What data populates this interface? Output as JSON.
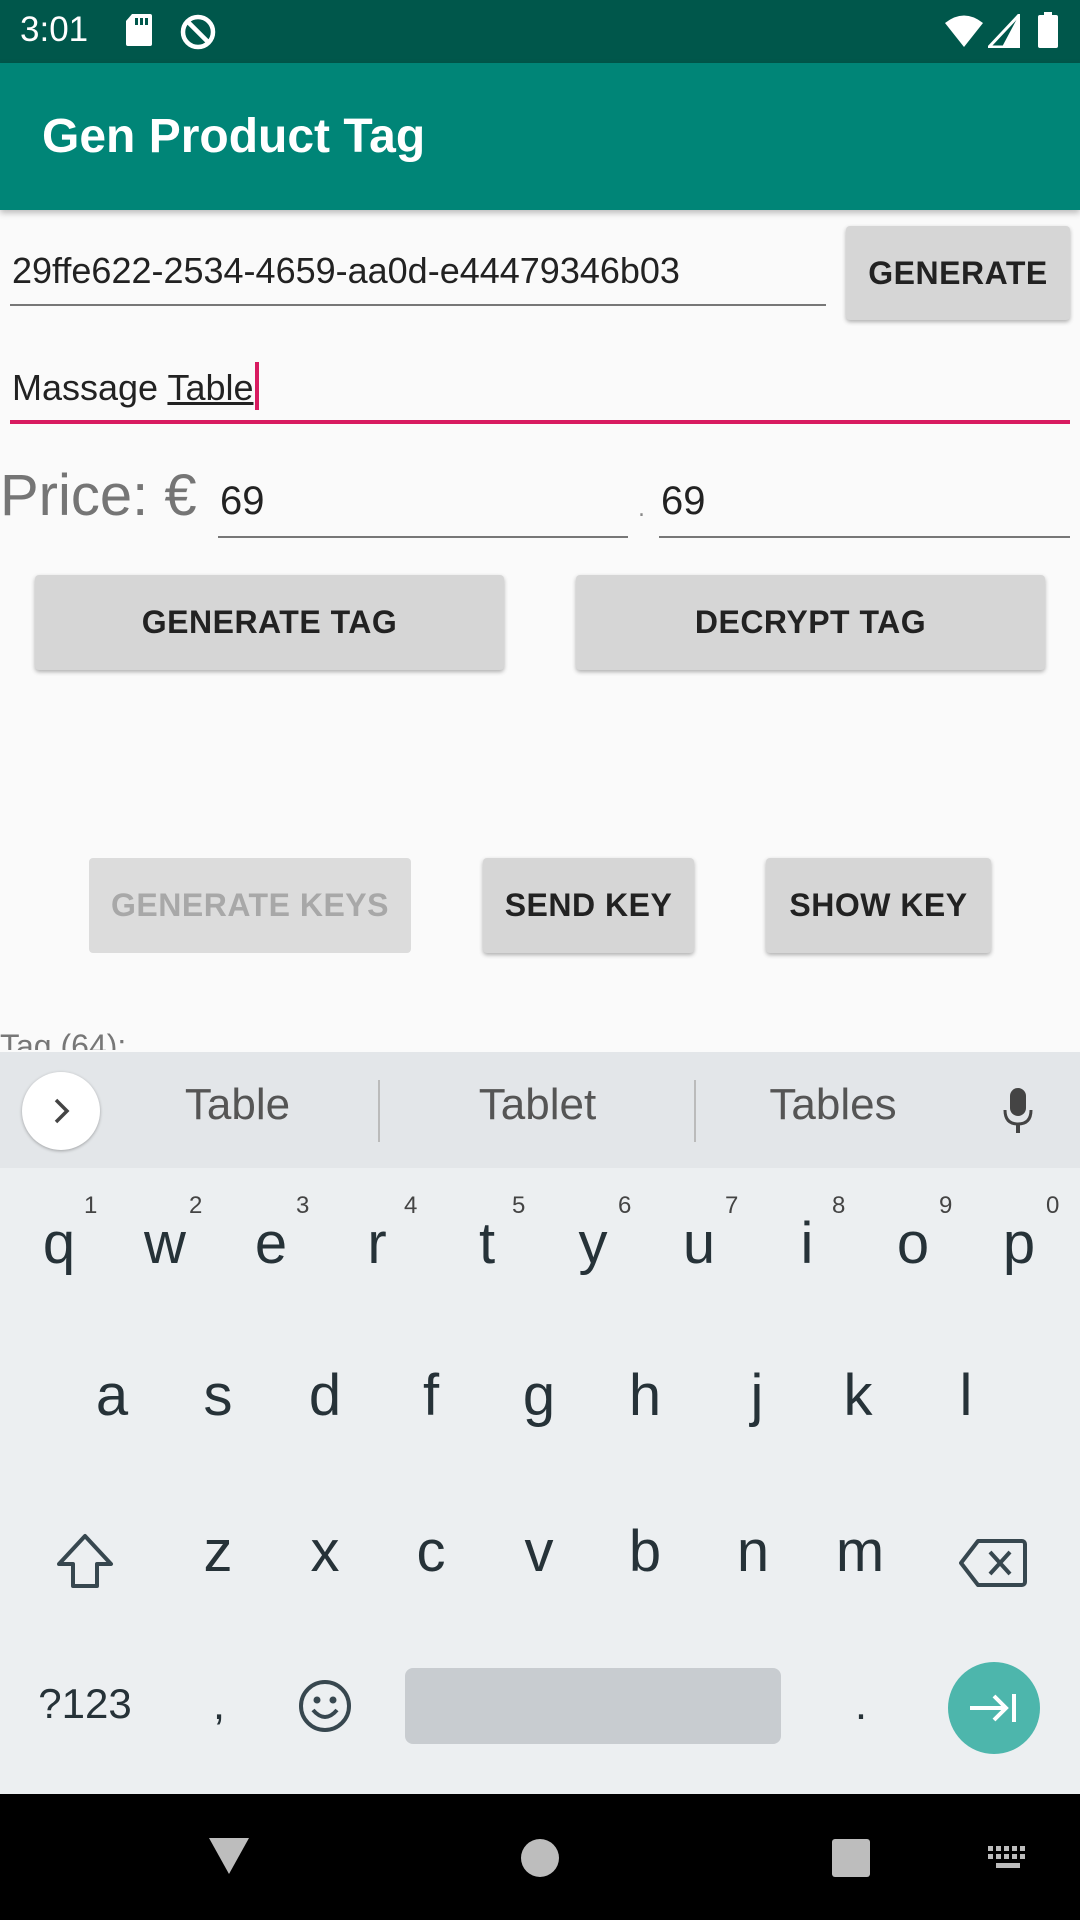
{
  "status_bar": {
    "time": "3:01",
    "icons": [
      "sd-card-icon",
      "sync-disabled-icon",
      "wifi-icon",
      "signal-icon",
      "battery-icon"
    ]
  },
  "app_bar": {
    "title": "Gen Product Tag"
  },
  "form": {
    "uuid_value": "29ffe622-2534-4659-aa0d-e44479346b03",
    "generate_label": "GENERATE",
    "name_value_part1": "Massage ",
    "name_value_part2": "Table",
    "price_label": "Price: €",
    "price_integer": "69",
    "decimal_separator": ".",
    "price_decimal": "69",
    "generate_tag_label": "GENERATE TAG",
    "decrypt_tag_label": "DECRYPT TAG",
    "generate_keys_label": "GENERATE KEYS",
    "send_key_label": "SEND KEY",
    "show_key_label": "SHOW KEY",
    "tag_label": "Tag (64):"
  },
  "keyboard": {
    "suggestions": [
      "Table",
      "Tablet",
      "Tables"
    ],
    "row1": [
      "q",
      "w",
      "e",
      "r",
      "t",
      "y",
      "u",
      "i",
      "o",
      "p"
    ],
    "row1_hints": [
      "1",
      "2",
      "3",
      "4",
      "5",
      "6",
      "7",
      "8",
      "9",
      "0"
    ],
    "row2": [
      "a",
      "s",
      "d",
      "f",
      "g",
      "h",
      "j",
      "k",
      "l"
    ],
    "row3": [
      "z",
      "x",
      "c",
      "v",
      "b",
      "n",
      "m"
    ],
    "symbols_label": "?123",
    "comma": ",",
    "period": "."
  },
  "colors": {
    "status_bar": "#00574b",
    "app_bar": "#008577",
    "accent": "#d81b60",
    "enter_key": "#4db6ac"
  }
}
